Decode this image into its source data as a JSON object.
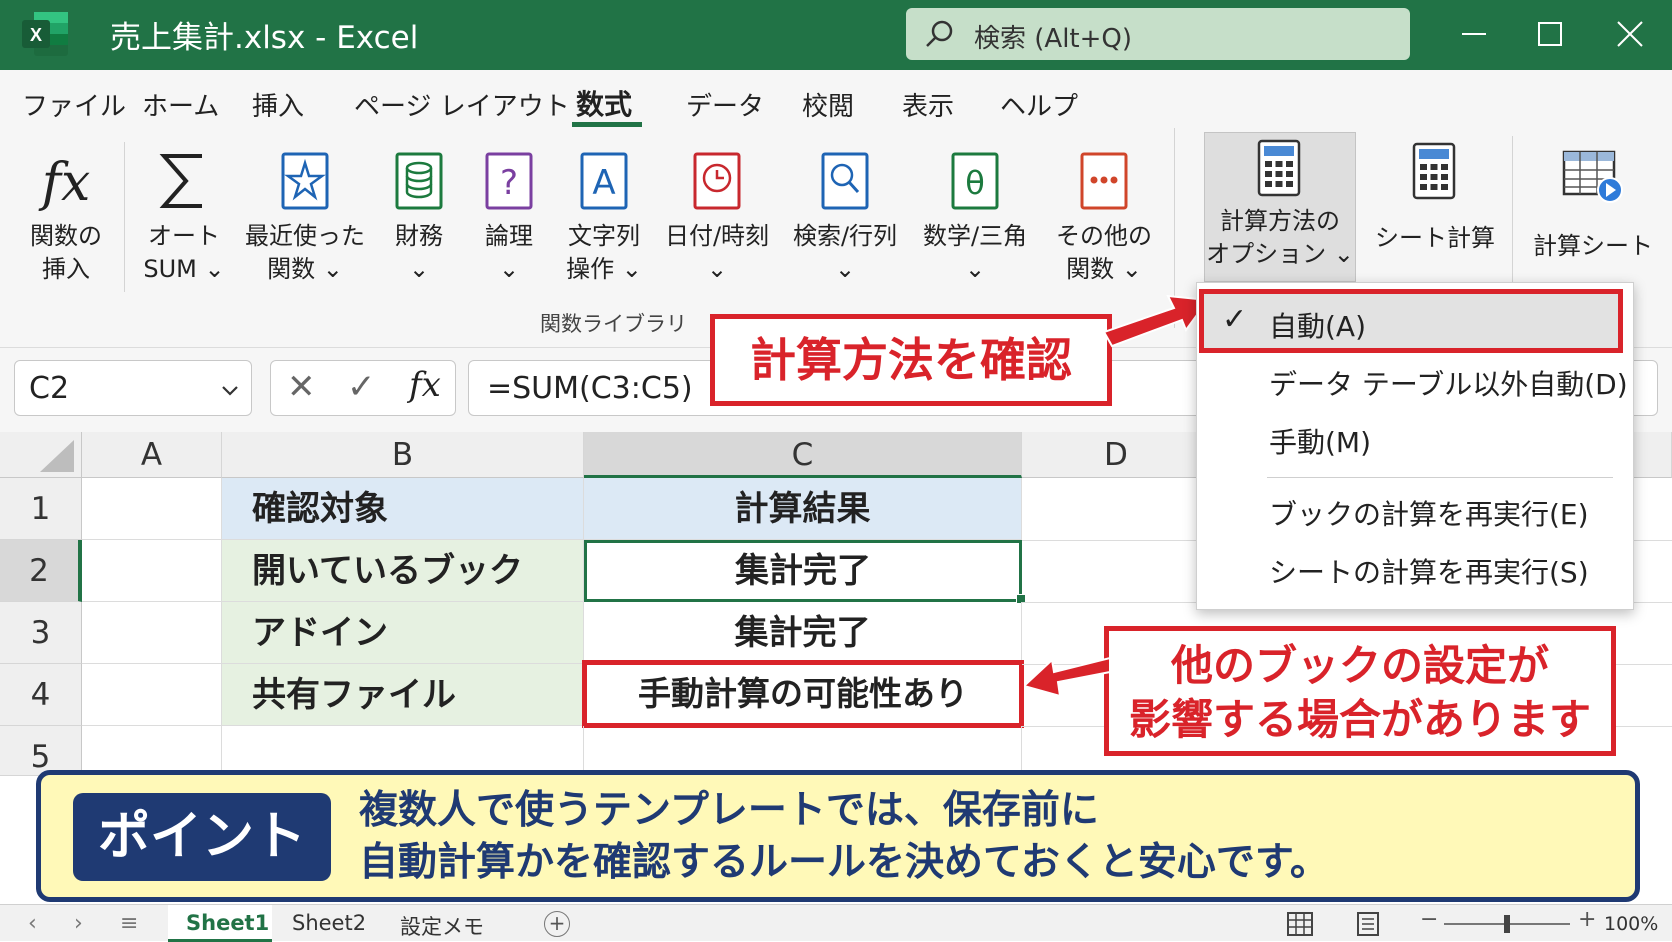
{
  "app": {
    "title": "売上集計.xlsx  -  Excel",
    "logo_letter": "X"
  },
  "search": {
    "placeholder": "検索 (Alt+Q)"
  },
  "menu_tabs": [
    "ファイル",
    "ホーム",
    "挿入",
    "ページ レイアウト",
    "数式",
    "データ",
    "校閲",
    "表示",
    "ヘルプ"
  ],
  "active_tab": "数式",
  "ribbon": {
    "buttons": [
      {
        "l1": "関数の",
        "l2": "挿入",
        "icon": "fx-icon"
      },
      {
        "l1": "オート",
        "l2": "SUM ⌄",
        "icon": "sigma-icon"
      },
      {
        "l1": "最近使った",
        "l2": "関数 ⌄",
        "icon": "star-book-icon"
      },
      {
        "l1": "財務",
        "l2": "⌄",
        "icon": "database-book-icon"
      },
      {
        "l1": "論理",
        "l2": "⌄",
        "icon": "question-book-icon"
      },
      {
        "l1": "文字列",
        "l2": "操作 ⌄",
        "icon": "text-book-icon"
      },
      {
        "l1": "日付/時刻",
        "l2": "⌄",
        "icon": "clock-book-icon"
      },
      {
        "l1": "検索/行列",
        "l2": "⌄",
        "icon": "search-book-icon"
      },
      {
        "l1": "数学/三角",
        "l2": "⌄",
        "icon": "theta-book-icon"
      },
      {
        "l1": "その他の",
        "l2": "関数 ⌄",
        "icon": "more-book-icon"
      }
    ],
    "group_label": "関数ライブラリ",
    "calc_options": {
      "l1": "計算方法の",
      "l2": "オプション ⌄"
    },
    "calc_sheet": "シート計算",
    "calc_workbook": "計算シート"
  },
  "formula_bar": {
    "name_box": "C2",
    "cancel": "✕",
    "enter": "✓",
    "fx": "fx",
    "formula": "=SUM(C3:C5)"
  },
  "grid": {
    "columns": [
      "A",
      "B",
      "C",
      "D"
    ],
    "rows": [
      "1",
      "2",
      "3",
      "4",
      "5"
    ],
    "header_b": "確認対象",
    "header_c": "計算結果",
    "data": [
      {
        "b": "開いているブック",
        "c": "集計完了"
      },
      {
        "b": "アドイン",
        "c": "集計完了"
      },
      {
        "b": "共有ファイル",
        "c": "手動計算の可能性あり"
      }
    ]
  },
  "dropdown": {
    "items": [
      "自動(A)",
      "データ テーブル以外自動(D)",
      "手動(M)"
    ],
    "actions": [
      "ブックの計算を再実行(E)",
      "シートの計算を再実行(S)"
    ],
    "checked": "✓"
  },
  "callouts": {
    "check_method": "計算方法を確認",
    "other_book": [
      "他のブックの設定が",
      "影響する場合があります"
    ]
  },
  "point": {
    "badge": "ポイント",
    "lines": [
      "複数人で使うテンプレートでは、保存前に",
      "自動計算かを確認するルールを決めておくと安心です。"
    ]
  },
  "status": {
    "sheets": [
      "Sheet1",
      "Sheet2",
      "設定メモ"
    ],
    "active_sheet": "Sheet1",
    "add": "+",
    "zoom": "100%"
  },
  "colors": {
    "excel_green": "#217346",
    "callout_red": "#d9232a",
    "point_navy": "#1f3a73",
    "point_bg": "#fff9b8",
    "header_blue": "#dce9f5",
    "col_b_green": "#e6f1e1"
  }
}
